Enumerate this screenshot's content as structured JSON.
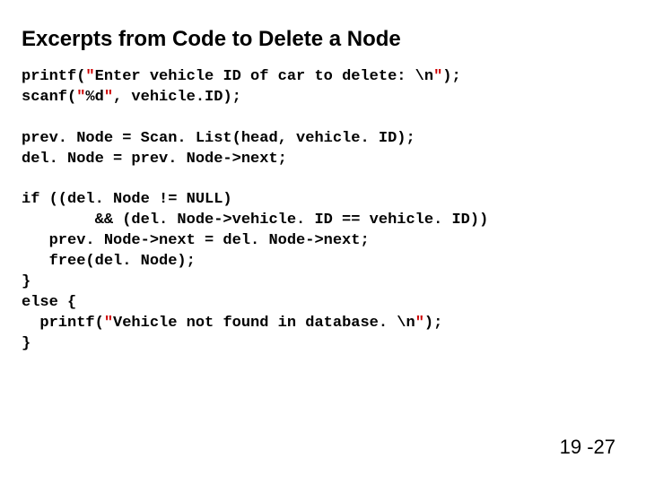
{
  "title": "Excerpts from Code to Delete a Node",
  "page_number": "19 -27",
  "code": {
    "l1a": "printf(",
    "l1b": "\"",
    "l1c": "Enter vehicle ID of car to delete: \\n",
    "l1d": "\"",
    "l1e": ");",
    "l2a": "scanf(",
    "l2b": "\"",
    "l2c": "%d",
    "l2d": "\"",
    "l2e": ", vehicle.ID);",
    "l3": "prev. Node = Scan. List(head, vehicle. ID);",
    "l4": "del. Node = prev. Node->next;",
    "l5": "if ((del. Node != NULL)",
    "l6": "        && (del. Node->vehicle. ID == vehicle. ID))",
    "l7": "   prev. Node->next = del. Node->next;",
    "l8": "   free(del. Node);",
    "l9": "}",
    "l10": "else {",
    "l11a": "  printf(",
    "l11b": "\"",
    "l11c": "Vehicle not found in database. \\n",
    "l11d": "\"",
    "l11e": ");",
    "l12": "}"
  }
}
